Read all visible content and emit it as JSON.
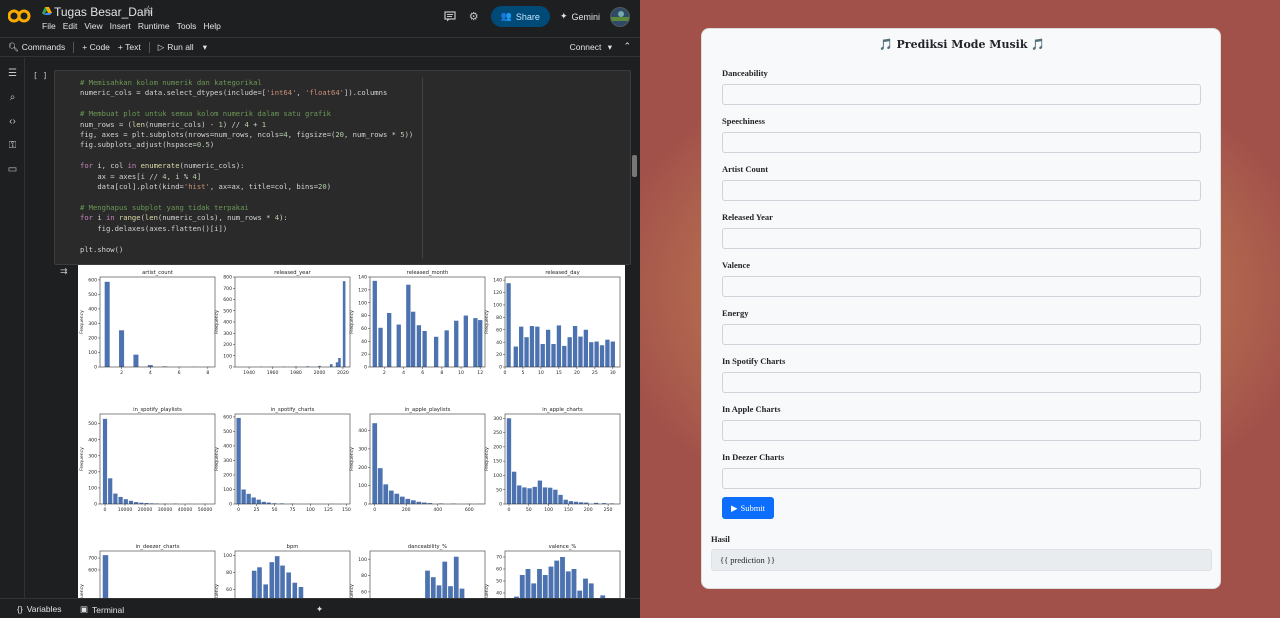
{
  "colab": {
    "notebook_title": "Tugas Besar_Dani",
    "menu": [
      "File",
      "Edit",
      "View",
      "Insert",
      "Runtime",
      "Tools",
      "Help"
    ],
    "share_label": "Share",
    "gemini_label": "Gemini",
    "toolbar": {
      "commands": "Commands",
      "code": "+ Code",
      "text": "+ Text",
      "run_all": "Run all",
      "connect": "Connect"
    },
    "cell_bracket": "[ ]",
    "code_lines": [
      "# Memisahkan kolom numerik dan kategorikal",
      "numeric_cols = data.select_dtypes(include=['int64', 'float64']).columns",
      "",
      "# Membuat plot untuk semua kolom numerik dalam satu grafik",
      "num_rows = (len(numeric_cols) - 1) // 4 + 1",
      "fig, axes = plt.subplots(nrows=num_rows, ncols=4, figsize=(20, num_rows * 5))",
      "fig.subplots_adjust(hspace=0.5)",
      "",
      "for i, col in enumerate(numeric_cols):",
      "    ax = axes[i // 4, i % 4]",
      "    data[col].plot(kind='hist', ax=ax, title=col, bins=20)",
      "",
      "# Menghapus subplot yang tidak terpakai",
      "for i in range(len(numeric_cols), num_rows * 4):",
      "    fig.delaxes(axes.flatten()[i])",
      "",
      "plt.show()"
    ],
    "bottom": {
      "variables": "Variables",
      "terminal": "Terminal"
    }
  },
  "chart_data": [
    {
      "type": "bar",
      "title": "artist_count",
      "ylabel": "Frequency",
      "xlim": [
        0.5,
        8.5
      ],
      "xticks": [
        2,
        4,
        6,
        8
      ],
      "ylim": [
        0,
        620
      ],
      "yticks": [
        0,
        100,
        200,
        300,
        400,
        500,
        600
      ],
      "bins": [
        [
          1,
          587
        ],
        [
          2,
          253
        ],
        [
          3,
          85
        ],
        [
          4,
          13
        ],
        [
          5,
          4
        ],
        [
          6,
          1
        ],
        [
          7,
          1
        ],
        [
          8,
          1
        ]
      ],
      "bin_width": 0.35
    },
    {
      "type": "bar",
      "title": "released_year",
      "ylabel": "Frequency",
      "xlim": [
        1928,
        2026
      ],
      "xticks": [
        1940,
        1960,
        1980,
        2000,
        2020
      ],
      "ylim": [
        0,
        800
      ],
      "yticks": [
        0,
        100,
        200,
        300,
        400,
        500,
        600,
        700,
        800
      ],
      "bins": [
        [
          1950,
          3
        ],
        [
          1960,
          3
        ],
        [
          1970,
          3
        ],
        [
          1980,
          5
        ],
        [
          1990,
          6
        ],
        [
          2000,
          10
        ],
        [
          2010,
          25
        ],
        [
          2015,
          42
        ],
        [
          2017,
          80
        ],
        [
          2021,
          763
        ]
      ],
      "bin_width": 2.2
    },
    {
      "type": "bar",
      "title": "released_month",
      "ylabel": "Frequency",
      "xlim": [
        0.5,
        12.5
      ],
      "xticks": [
        2,
        4,
        6,
        8,
        10,
        12
      ],
      "ylim": [
        0,
        140
      ],
      "yticks": [
        0,
        20,
        40,
        60,
        80,
        100,
        120,
        140
      ],
      "bins": [
        [
          1,
          134
        ],
        [
          1.6,
          61
        ],
        [
          2.5,
          84
        ],
        [
          3.5,
          66
        ],
        [
          4.5,
          128
        ],
        [
          5,
          86
        ],
        [
          5.6,
          65
        ],
        [
          6.2,
          56
        ],
        [
          7.4,
          47
        ],
        [
          8.5,
          57
        ],
        [
          9.5,
          72
        ],
        [
          10.5,
          80
        ],
        [
          11.5,
          76
        ],
        [
          12,
          73
        ]
      ],
      "bin_width": 0.45
    },
    {
      "type": "bar",
      "title": "released_day",
      "ylabel": "Frequency",
      "xlim": [
        0,
        32
      ],
      "xticks": [
        0,
        5,
        10,
        15,
        20,
        25,
        30
      ],
      "ylim": [
        0,
        145
      ],
      "yticks": [
        0,
        20,
        40,
        60,
        80,
        100,
        120,
        140
      ],
      "bins": [
        [
          1,
          135
        ],
        [
          3,
          33
        ],
        [
          4.5,
          65
        ],
        [
          6,
          48
        ],
        [
          7.5,
          66
        ],
        [
          9,
          65
        ],
        [
          10.5,
          37
        ],
        [
          12,
          60
        ],
        [
          13.5,
          37
        ],
        [
          15,
          67
        ],
        [
          16.5,
          34
        ],
        [
          18,
          48
        ],
        [
          19.5,
          66
        ],
        [
          21,
          49
        ],
        [
          22.5,
          60
        ],
        [
          24,
          40
        ],
        [
          25.5,
          41
        ],
        [
          27,
          35
        ],
        [
          28.5,
          44
        ],
        [
          30,
          41
        ]
      ],
      "bin_width": 1.2
    },
    {
      "type": "bar",
      "title": "in_spotify_playlists",
      "ylabel": "Frequency",
      "xlim": [
        -2500,
        55000
      ],
      "xticks": [
        0,
        10000,
        20000,
        30000,
        40000,
        50000
      ],
      "ylim": [
        0,
        560
      ],
      "yticks": [
        0,
        100,
        200,
        300,
        400,
        500
      ],
      "bins": [
        [
          0,
          530
        ],
        [
          2600,
          160
        ],
        [
          5200,
          65
        ],
        [
          7800,
          44
        ],
        [
          10400,
          30
        ],
        [
          13000,
          20
        ],
        [
          15600,
          12
        ],
        [
          18200,
          8
        ],
        [
          20800,
          6
        ],
        [
          23400,
          4
        ],
        [
          26000,
          3
        ],
        [
          30000,
          2
        ],
        [
          35000,
          2
        ],
        [
          42000,
          1
        ],
        [
          50000,
          1
        ]
      ],
      "bin_width": 2100
    },
    {
      "type": "bar",
      "title": "in_spotify_charts",
      "ylabel": "Frequency",
      "xlim": [
        -5,
        155
      ],
      "xticks": [
        0,
        25,
        50,
        75,
        100,
        125,
        150
      ],
      "ylim": [
        0,
        620
      ],
      "yticks": [
        0,
        100,
        200,
        300,
        400,
        500,
        600
      ],
      "bins": [
        [
          0,
          593
        ],
        [
          7,
          100
        ],
        [
          14,
          70
        ],
        [
          21,
          45
        ],
        [
          28,
          30
        ],
        [
          35,
          15
        ],
        [
          42,
          10
        ],
        [
          50,
          5
        ],
        [
          60,
          4
        ],
        [
          75,
          2
        ],
        [
          100,
          1
        ],
        [
          130,
          1
        ]
      ],
      "bin_width": 6
    },
    {
      "type": "bar",
      "title": "in_apple_playlists",
      "ylabel": "Frequency",
      "xlim": [
        -30,
        700
      ],
      "xticks": [
        0,
        200,
        400,
        600
      ],
      "ylim": [
        0,
        490
      ],
      "yticks": [
        0,
        100,
        200,
        300,
        400
      ],
      "bins": [
        [
          0,
          440
        ],
        [
          35,
          195
        ],
        [
          70,
          107
        ],
        [
          105,
          73
        ],
        [
          140,
          56
        ],
        [
          175,
          40
        ],
        [
          210,
          28
        ],
        [
          245,
          20
        ],
        [
          280,
          12
        ],
        [
          315,
          8
        ],
        [
          350,
          5
        ],
        [
          420,
          3
        ],
        [
          500,
          2
        ],
        [
          600,
          1
        ],
        [
          670,
          1
        ]
      ],
      "bin_width": 30
    },
    {
      "type": "bar",
      "title": "in_apple_charts",
      "ylabel": "Frequency",
      "xlim": [
        -10,
        280
      ],
      "xticks": [
        0,
        50,
        100,
        150,
        200,
        250
      ],
      "ylim": [
        0,
        315
      ],
      "yticks": [
        0,
        50,
        100,
        150,
        200,
        250,
        300
      ],
      "bins": [
        [
          0,
          300
        ],
        [
          13,
          113
        ],
        [
          26,
          65
        ],
        [
          39,
          58
        ],
        [
          52,
          55
        ],
        [
          65,
          60
        ],
        [
          78,
          82
        ],
        [
          91,
          58
        ],
        [
          104,
          57
        ],
        [
          117,
          50
        ],
        [
          130,
          32
        ],
        [
          143,
          15
        ],
        [
          156,
          10
        ],
        [
          169,
          8
        ],
        [
          182,
          6
        ],
        [
          195,
          5
        ],
        [
          220,
          4
        ],
        [
          240,
          3
        ],
        [
          260,
          2
        ]
      ],
      "bin_width": 11
    },
    {
      "type": "bar",
      "title": "in_deezer_charts",
      "ylabel": "Frequency",
      "xlim": [
        -3,
        60
      ],
      "xticks": [],
      "ylim": [
        0,
        760
      ],
      "yticks": [
        600,
        700
      ],
      "bins": [
        [
          0,
          725
        ]
      ],
      "bin_width": 3
    },
    {
      "type": "bar",
      "title": "bpm",
      "ylabel": "Frequency",
      "xlim": [
        60,
        210
      ],
      "xticks": [],
      "ylim": [
        0,
        105
      ],
      "yticks": [
        60,
        80,
        100
      ],
      "bins": [
        [
          85,
          82
        ],
        [
          92,
          86
        ],
        [
          100,
          66
        ],
        [
          108,
          92
        ],
        [
          115,
          99
        ],
        [
          122,
          88
        ],
        [
          130,
          80
        ],
        [
          138,
          68
        ],
        [
          146,
          63
        ]
      ],
      "bin_width": 6
    },
    {
      "type": "bar",
      "title": "danceability_%",
      "ylabel": "Frequency",
      "xlim": [
        20,
        100
      ],
      "xticks": [],
      "ylim": [
        0,
        110
      ],
      "yticks": [
        60,
        80,
        100
      ],
      "bins": [
        [
          60,
          86
        ],
        [
          64,
          78
        ],
        [
          68,
          68
        ],
        [
          72,
          97
        ],
        [
          76,
          67
        ],
        [
          80,
          103
        ],
        [
          84,
          64
        ]
      ],
      "bin_width": 3.3
    },
    {
      "type": "bar",
      "title": "valence_%",
      "ylabel": "Frequency",
      "xlim": [
        0,
        100
      ],
      "xticks": [],
      "ylim": [
        0,
        75
      ],
      "yticks": [
        40,
        50,
        60,
        70
      ],
      "bins": [
        [
          10,
          37
        ],
        [
          15,
          55
        ],
        [
          20,
          60
        ],
        [
          25,
          48
        ],
        [
          30,
          60
        ],
        [
          35,
          55
        ],
        [
          40,
          62
        ],
        [
          45,
          67
        ],
        [
          50,
          70
        ],
        [
          55,
          58
        ],
        [
          60,
          60
        ],
        [
          65,
          42
        ],
        [
          70,
          52
        ],
        [
          75,
          48
        ],
        [
          80,
          30
        ],
        [
          85,
          38
        ],
        [
          90,
          35
        ]
      ],
      "bin_width": 4.2
    }
  ],
  "form": {
    "title": "🎵 Prediksi Mode Musik 🎵",
    "fields": [
      "Danceability",
      "Speechiness",
      "Artist Count",
      "Released Year",
      "Valence",
      "Energy",
      "In Spotify Charts",
      "In Apple Charts",
      "In Deezer Charts"
    ],
    "submit_label": "Submit",
    "result_label": "Hasil",
    "result_text": "{{ prediction }}"
  },
  "colors": {
    "accent": "#0d6efd",
    "bar": "#4c72b0",
    "colab_bg": "#1e1f20"
  }
}
